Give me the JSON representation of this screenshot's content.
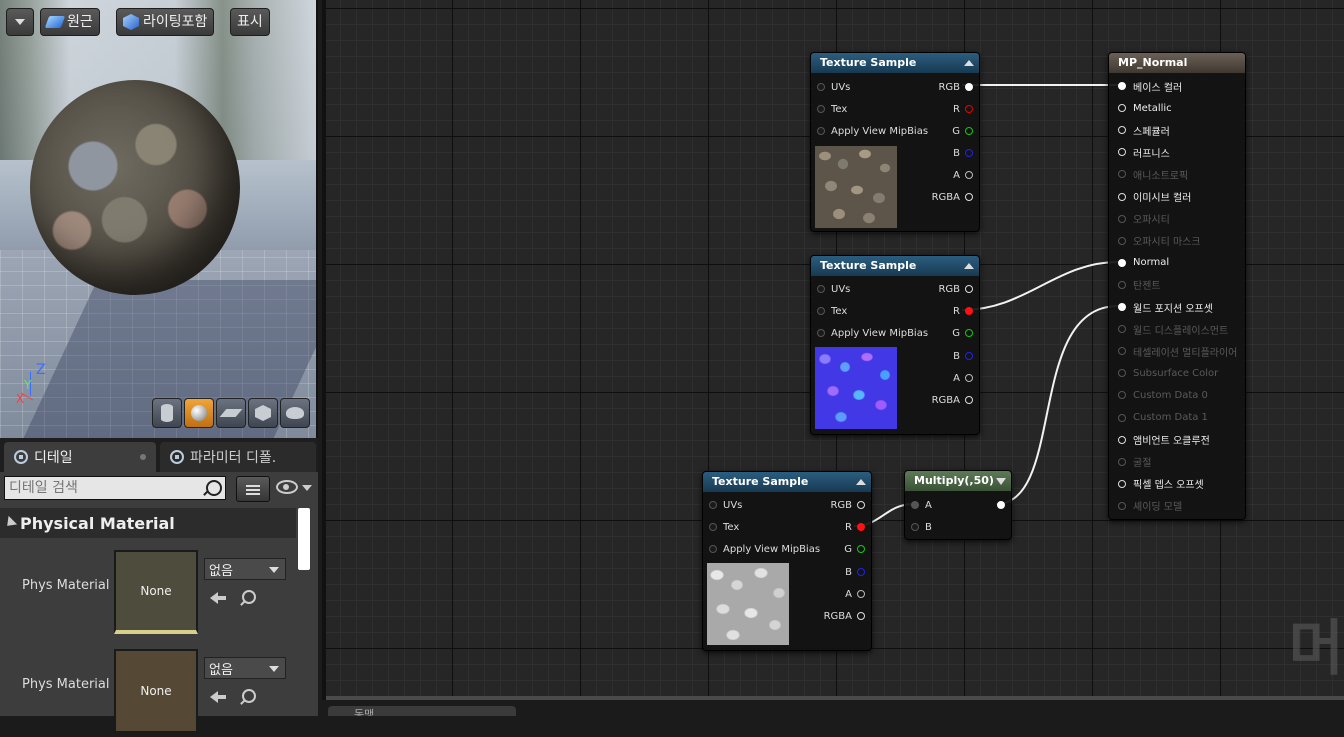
{
  "viewport": {
    "menu_caret": "chevron-down-icon",
    "btn_perspective": "원근",
    "btn_lighting": "라이팅포함",
    "btn_show": "표시",
    "axis_z": "Z",
    "axis_y": "Y",
    "axis_x": "X",
    "preview_shapes": [
      "cylinder-icon",
      "sphere-icon",
      "plane-icon",
      "cube-icon",
      "teapot-icon"
    ]
  },
  "details": {
    "tab_details": "디테일",
    "tab_params": "파라미터 디폴.",
    "search_placeholder": "디테일 검색",
    "category": "Physical Material",
    "rows": [
      {
        "label": "Phys Material",
        "thumb": "None",
        "combo": "없음"
      },
      {
        "label": "Phys Material",
        "thumb": "None",
        "combo": "없음"
      }
    ]
  },
  "graph": {
    "texture_nodes": [
      {
        "title": "Texture Sample",
        "inputs": [
          "UVs",
          "Tex",
          "Apply View MipBias"
        ],
        "outputs": [
          "RGB",
          "R",
          "G",
          "B",
          "A",
          "RGBA"
        ],
        "preview": "stone-diffuse"
      },
      {
        "title": "Texture Sample",
        "inputs": [
          "UVs",
          "Tex",
          "Apply View MipBias"
        ],
        "outputs": [
          "RGB",
          "R",
          "G",
          "B",
          "A",
          "RGBA"
        ],
        "preview": "stone-normal"
      },
      {
        "title": "Texture Sample",
        "inputs": [
          "UVs",
          "Tex",
          "Apply View MipBias"
        ],
        "outputs": [
          "RGB",
          "R",
          "G",
          "B",
          "A",
          "RGBA"
        ],
        "preview": "stone-height"
      }
    ],
    "multiply_node": {
      "title": "Multiply(,50)",
      "inputs": [
        "A",
        "B"
      ]
    },
    "result_node": {
      "title": "MP_Normal",
      "pins": [
        {
          "label": "베이스 컬러",
          "active": true
        },
        {
          "label": "Metallic",
          "active": true
        },
        {
          "label": "스페큘러",
          "active": true
        },
        {
          "label": "러프니스",
          "active": true
        },
        {
          "label": "애니소트로픽",
          "active": false
        },
        {
          "label": "이미시브 컬러",
          "active": true
        },
        {
          "label": "오파시티",
          "active": false
        },
        {
          "label": "오파시티 마스크",
          "active": false
        },
        {
          "label": "Normal",
          "active": true
        },
        {
          "label": "탄젠트",
          "active": false
        },
        {
          "label": "월드 포지션 오프셋",
          "active": true
        },
        {
          "label": "월드 디스플레이스먼트",
          "active": false
        },
        {
          "label": "테셀레이션 멀티플라이어",
          "active": false
        },
        {
          "label": "Subsurface Color",
          "active": false
        },
        {
          "label": "Custom Data 0",
          "active": false
        },
        {
          "label": "Custom Data 1",
          "active": false
        },
        {
          "label": "앰비언트 오클루전",
          "active": true
        },
        {
          "label": "굴절",
          "active": false
        },
        {
          "label": "픽셀 뎁스 오프셋",
          "active": true
        },
        {
          "label": "셰이딩 모델",
          "active": false
        }
      ]
    },
    "watermark": "머"
  },
  "bottom_tab": {
    "label": "동맹"
  },
  "colors": {
    "texture_header": "#2b5d7f",
    "multiply_header": "#5d7a57",
    "result_header": "#6b6057",
    "wire": "#f2f2f2"
  }
}
